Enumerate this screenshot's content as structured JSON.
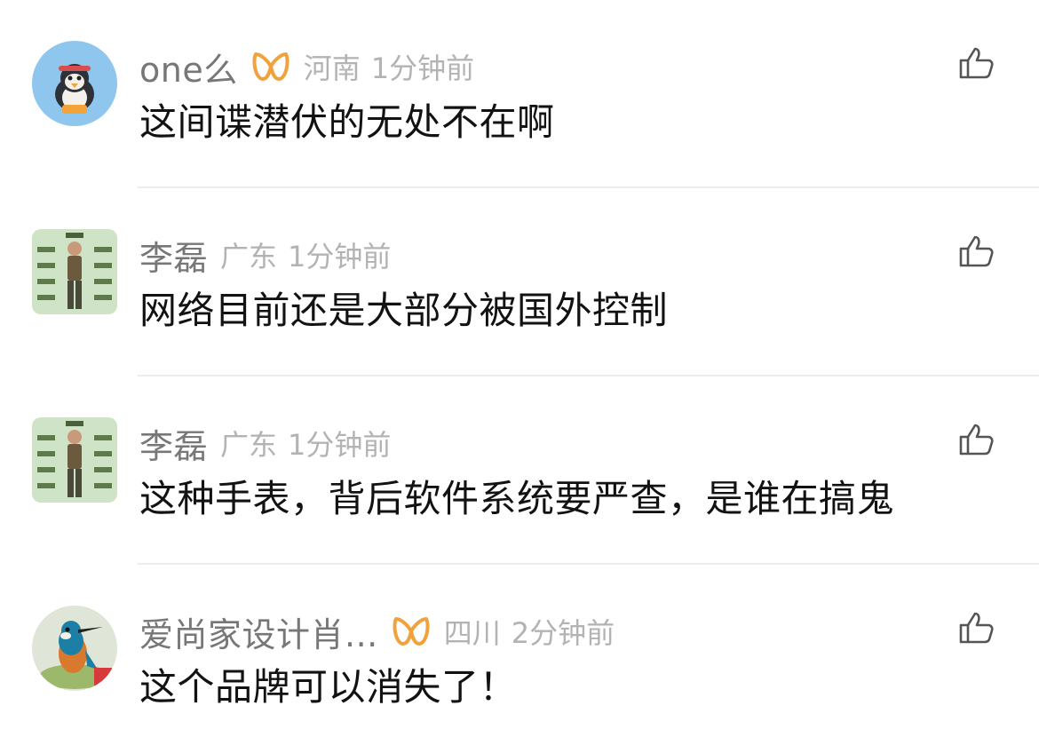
{
  "comments": [
    {
      "username": "one么",
      "has_vip_badge": true,
      "location": "河南",
      "time": "1分钟前",
      "content": "这间谍潜伏的无处不在啊",
      "avatar_icon": "penguin-avatar-icon"
    },
    {
      "username": "李磊",
      "has_vip_badge": false,
      "location": "广东",
      "time": "1分钟前",
      "content": "网络目前还是大部分被国外控制",
      "avatar_icon": "boy-poster-avatar-icon"
    },
    {
      "username": "李磊",
      "has_vip_badge": false,
      "location": "广东",
      "time": "1分钟前",
      "content": "这种手表，背后软件系统要严查，是谁在搞鬼",
      "avatar_icon": "boy-poster-avatar-icon"
    },
    {
      "username": "爱尚家设计肖...",
      "has_vip_badge": true,
      "location": "四川",
      "time": "2分钟前",
      "content": "这个品牌可以消失了！",
      "avatar_icon": "kingfisher-avatar-icon"
    }
  ],
  "colors": {
    "username": "#777777",
    "meta": "#b3b3b3",
    "content": "#121212",
    "vip_badge": "#f0a23c",
    "divider": "#ececec",
    "like_icon": "#555555"
  },
  "icons": {
    "like": "thumbs-up-icon",
    "vip": "vip-badge-icon"
  }
}
